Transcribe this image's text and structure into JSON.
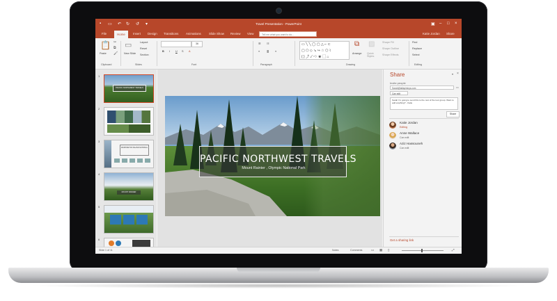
{
  "window": {
    "title": "Travel Presentation - PowerPoint",
    "user": "Katie Jordan",
    "share_button": "Share",
    "tell_me_placeholder": "Tell me what you want to do..."
  },
  "ribbon_tabs": [
    "File",
    "Home",
    "Insert",
    "Design",
    "Transitions",
    "Animations",
    "Slide Show",
    "Review",
    "View"
  ],
  "ribbon": {
    "paste": "Paste",
    "new_slide": "New Slide",
    "layout": "Layout",
    "reset": "Reset",
    "section": "Section",
    "arrange": "Arrange",
    "quick_styles": "Quick Styles",
    "shape_fill": "Shape Fill",
    "shape_outline": "Shape Outline",
    "shape_effects": "Shape Effects",
    "find": "Find",
    "replace": "Replace",
    "select": "Select",
    "font_size": "36",
    "groups": {
      "clipboard": "Clipboard",
      "slides": "Slides",
      "font": "Font",
      "paragraph": "Paragraph",
      "drawing": "Drawing",
      "editing": "Editing"
    }
  },
  "thumbnails": {
    "numbers": [
      "1",
      "2",
      "3",
      "4",
      "5",
      "6"
    ],
    "t1_title": "PACIFIC NORTHWEST TRAVELS",
    "t3_title": "WASHINGTON ISLAND NATIONAL",
    "t4_title": "MOUNT RAINIER"
  },
  "slide": {
    "title": "PACIFIC NORTHWEST TRAVELS",
    "subtitle": "Mount Rainier , Olympic National Park"
  },
  "share": {
    "title": "Share",
    "invite_label": "Invite people",
    "invite_value": "Sarah@tailspintoys.com",
    "permission": "Can edit",
    "message": "Sarah I'm going to send this to the rest of the tour group. Want to add anything? - Katie",
    "share_button": "Share",
    "people": [
      {
        "name": "Katie Jordan",
        "status": "Editing"
      },
      {
        "name": "Anne Wallace",
        "status": "Can edit"
      },
      {
        "name": "Aziz Hassouneh",
        "status": "Can edit"
      }
    ],
    "get_link": "Get a sharing link"
  },
  "status": {
    "slide_count": "Slide 1 of 11",
    "notes": "Notes",
    "comments": "Comments"
  },
  "colors": {
    "accent": "#b7472a",
    "screen_bg": "#f3f3f3"
  }
}
